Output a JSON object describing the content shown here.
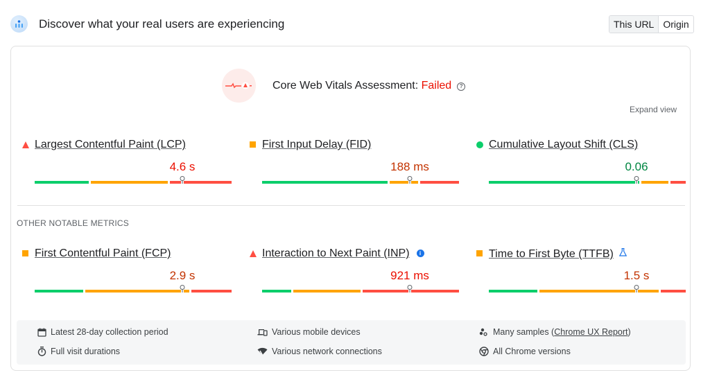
{
  "header": {
    "icon": "crux-users-icon",
    "title": "Discover what your real users are experiencing",
    "toggle": [
      {
        "label": "This URL",
        "active": true
      },
      {
        "label": "Origin",
        "active": false
      }
    ]
  },
  "assessment": {
    "icon": "failed-pulse-icon",
    "label": "Core Web Vitals Assessment: ",
    "status": "Failed",
    "status_color": "#eb0f00",
    "help_icon": "?",
    "expand_label": "Expand view"
  },
  "colors": {
    "good": "#0cce6b",
    "needs_improvement": "#ffa400",
    "poor": "#ff4e42",
    "value_average": "#c33300",
    "value_poor": "#eb0f00",
    "value_good": "#018642"
  },
  "core_metrics": [
    {
      "name": "Largest Contentful Paint (LCP)",
      "rating": "poor",
      "indicator": "triangle",
      "value": "4.6 s",
      "distribution": {
        "good": 0.28,
        "needs_improvement": 0.4,
        "poor": 0.32
      },
      "percentile_position": 0.75
    },
    {
      "name": "First Input Delay (FID)",
      "rating": "needs-improvement",
      "indicator": "square",
      "value": "188 ms",
      "distribution": {
        "good": 0.65,
        "needs_improvement": 0.15,
        "poor": 0.2
      },
      "percentile_position": 0.75
    },
    {
      "name": "Cumulative Layout Shift (CLS)",
      "rating": "good",
      "indicator": "circle",
      "value": "0.06",
      "distribution": {
        "good": 0.78,
        "needs_improvement": 0.14,
        "poor": 0.08
      },
      "percentile_position": 0.75
    }
  ],
  "other_label": "OTHER NOTABLE METRICS",
  "other_metrics": [
    {
      "name": "First Contentful Paint (FCP)",
      "rating": "needs-improvement",
      "indicator": "square",
      "value": "2.9 s",
      "distribution": {
        "good": 0.25,
        "needs_improvement": 0.54,
        "poor": 0.21
      },
      "percentile_position": 0.75,
      "badge": null
    },
    {
      "name": "Interaction to Next Paint (INP)",
      "rating": "poor",
      "indicator": "triangle",
      "value": "921 ms",
      "distribution": {
        "good": 0.15,
        "needs_improvement": 0.35,
        "poor": 0.5
      },
      "percentile_position": 0.75,
      "badge": "info-icon"
    },
    {
      "name": "Time to First Byte (TTFB)",
      "rating": "needs-improvement",
      "indicator": "square",
      "value": "1.5 s",
      "distribution": {
        "good": 0.25,
        "needs_improvement": 0.62,
        "poor": 0.13
      },
      "percentile_position": 0.75,
      "badge": "flask-icon"
    }
  ],
  "footer": {
    "items": [
      {
        "icon": "calendar-icon",
        "text": "Latest 28-day collection period"
      },
      {
        "icon": "devices-icon",
        "text": "Various mobile devices"
      },
      {
        "icon": "samples-icon",
        "text": "Many samples (",
        "link": "Chrome UX Report",
        "suffix": ")"
      },
      {
        "icon": "stopwatch-icon",
        "text": "Full visit durations"
      },
      {
        "icon": "network-icon",
        "text": "Various network connections"
      },
      {
        "icon": "chrome-icon",
        "text": "All Chrome versions"
      }
    ]
  }
}
